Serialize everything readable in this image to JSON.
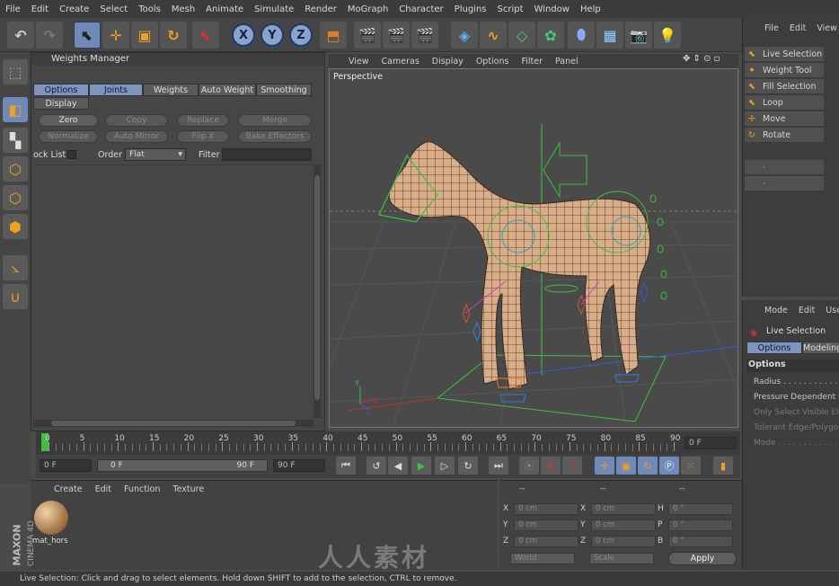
{
  "menubar": [
    "File",
    "Edit",
    "Create",
    "Select",
    "Tools",
    "Mesh",
    "Animate",
    "Simulate",
    "Render",
    "MoGraph",
    "Character",
    "Plugins",
    "Script",
    "Window",
    "Help"
  ],
  "toolbar": {
    "undo_icon": "undo-icon",
    "redo_icon": "redo-icon",
    "x_label": "X",
    "y_label": "Y",
    "z_label": "Z"
  },
  "weights_manager": {
    "title": "Weights Manager",
    "tabs": [
      "Options",
      "Joints",
      "Weights",
      "Auto Weight",
      "Smoothing",
      "Display"
    ],
    "buttons_row1": [
      "Zero",
      "Copy",
      "Replace",
      "Merge"
    ],
    "buttons_row2": [
      "Normalize",
      "Auto Mirror",
      "Flip X",
      "Bake Effectors"
    ],
    "lock_list_label": "ock List",
    "order_label": "Order",
    "order_value": "Flat",
    "filter_label": "Filter"
  },
  "viewport": {
    "menu": [
      "View",
      "Cameras",
      "Display",
      "Options",
      "Filter",
      "Panel"
    ],
    "name": "Perspective",
    "axis_y": "Y",
    "axis_z": "Z",
    "axis_x": "X"
  },
  "right_panel": {
    "menu": [
      "File",
      "Edit",
      "View"
    ],
    "tools": [
      "Live Selection",
      "Weight Tool",
      "Fill Selection",
      "Loop Selection",
      "Move",
      "Rotate"
    ]
  },
  "attributes": {
    "menu": [
      "Mode",
      "Edit",
      "User"
    ],
    "tool_name": "Live Selection",
    "tabs": [
      "Options",
      "Modeling"
    ],
    "section": "Options",
    "rows": [
      {
        "label": "Radius . . . . . . . . . . . . .",
        "dim": false
      },
      {
        "label": "Pressure Dependent R",
        "dim": false
      },
      {
        "label": "Only Select Visible Elen",
        "dim": true
      },
      {
        "label": "Tolerant Edge/Polygon",
        "dim": true
      },
      {
        "label": "Mode . . . . . . . . . . . . . .",
        "dim": true
      }
    ]
  },
  "timeline": {
    "labels": [
      "0",
      "5",
      "10",
      "15",
      "20",
      "25",
      "30",
      "35",
      "40",
      "45",
      "50",
      "55",
      "60",
      "65",
      "70",
      "75",
      "80",
      "85",
      "90"
    ],
    "current_frame": "0 F"
  },
  "transport": {
    "start": "0 F",
    "range_start": "0 F",
    "range_end": "90 F",
    "end": "90 F"
  },
  "materials": {
    "menu": [
      "Create",
      "Edit",
      "Function",
      "Texture"
    ],
    "material_name": "mat_hors"
  },
  "coordinates": {
    "header1": "--",
    "header2": "--",
    "header3": "--",
    "pos": [
      {
        "axis": "X",
        "value": "0 cm"
      },
      {
        "axis": "Y",
        "value": "0 cm"
      },
      {
        "axis": "Z",
        "value": "0 cm"
      }
    ],
    "size": [
      {
        "axis": "X",
        "value": "0 cm"
      },
      {
        "axis": "Y",
        "value": "0 cm"
      },
      {
        "axis": "Z",
        "value": "0 cm"
      }
    ],
    "rot": [
      {
        "axis": "H",
        "value": "0 °"
      },
      {
        "axis": "P",
        "value": "0 °"
      },
      {
        "axis": "B",
        "value": "0 °"
      }
    ],
    "world": "World",
    "scale": "Scale",
    "apply": "Apply"
  },
  "branding": {
    "maxon": "MAXON",
    "cinema": "CINEMA 4D",
    "watermark": "人人素材"
  },
  "status": "Live Selection: Click and drag to select elements. Hold down SHIFT to add to the selection, CTRL to remove."
}
